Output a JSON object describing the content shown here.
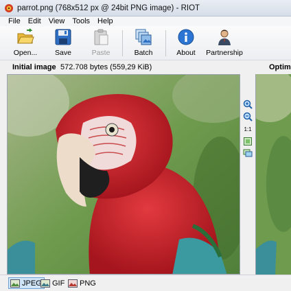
{
  "window": {
    "title": "parrot.png (768x512 px @ 24bit PNG image) - RIOT",
    "icon": "riot-app-icon"
  },
  "menu": [
    {
      "label": "File"
    },
    {
      "label": "Edit"
    },
    {
      "label": "View"
    },
    {
      "label": "Tools"
    },
    {
      "label": "Help"
    }
  ],
  "toolbar": {
    "open_label": "Open...",
    "save_label": "Save",
    "paste_label": "Paste",
    "batch_label": "Batch",
    "about_label": "About",
    "partnership_label": "Partnership"
  },
  "info": {
    "initial_title": "Initial image",
    "initial_size": "572.708 bytes (559,29 KiB)",
    "optimized_title": "Optimi"
  },
  "side_tools": {
    "ratio_label": "1:1",
    "icons": [
      "zoom-in-icon",
      "zoom-out-icon",
      "fit-icon",
      "compare-icon"
    ]
  },
  "tabs": [
    {
      "label": "JPEG",
      "active": true
    },
    {
      "label": "GIF",
      "active": false
    },
    {
      "label": "PNG",
      "active": false
    }
  ],
  "colors": {
    "accent": "#6ea1d3",
    "parrot_red": "#c8202a",
    "foliage": "#6f9b4e"
  }
}
